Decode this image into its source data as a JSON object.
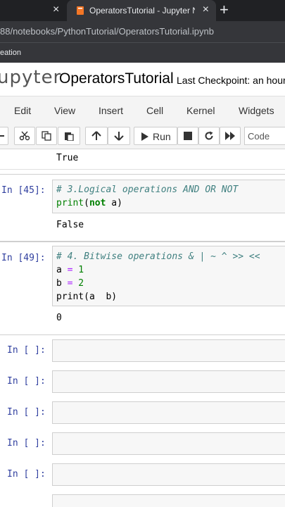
{
  "browser": {
    "prev_tab_close": "×",
    "tab_title": "OperatorsTutorial - Jupyter Note",
    "tab_close": "×",
    "new_tab": "+",
    "url": "88/notebooks/PythonTutorial/OperatorsTutorial.ipynb",
    "bookmark": "eation"
  },
  "header": {
    "logo": "upyter",
    "notebook_title": "OperatorsTutorial",
    "checkpoint": "Last Checkpoint: an hour"
  },
  "menu": [
    "Edit",
    "View",
    "Insert",
    "Cell",
    "Kernel",
    "Widgets"
  ],
  "toolbar": {
    "run_label": "Run",
    "cell_type": "Code",
    "icons": [
      "scissors-icon",
      "copy-icon",
      "paste-icon",
      "arrow-up-icon",
      "arrow-down-icon",
      "play-icon",
      "stop-icon",
      "restart-icon",
      "fast-forward-icon"
    ]
  },
  "cells": {
    "top_output": "True",
    "cell45": {
      "prompt": "In [45]:",
      "line1": "# 3.Logical operations AND OR NOT",
      "line2_fn": "print",
      "line2_open": "(",
      "line2_kw": "not",
      "line2_rest": " a)",
      "output": "False"
    },
    "cell49": {
      "prompt": "In [49]:",
      "line1": "# 4. Bitwise operations & | ~ ^ >> <<",
      "line2_var": "a ",
      "line2_op": "=",
      "line2_num": " 1",
      "line3_var": "b ",
      "line3_op": "=",
      "line3_num": " 2",
      "line4": "print(a  b)",
      "output": "0"
    },
    "empty_prompts": [
      "In [ ]:",
      "In [ ]:",
      "In [ ]:",
      "In [ ]:",
      "In [ ]:"
    ]
  }
}
